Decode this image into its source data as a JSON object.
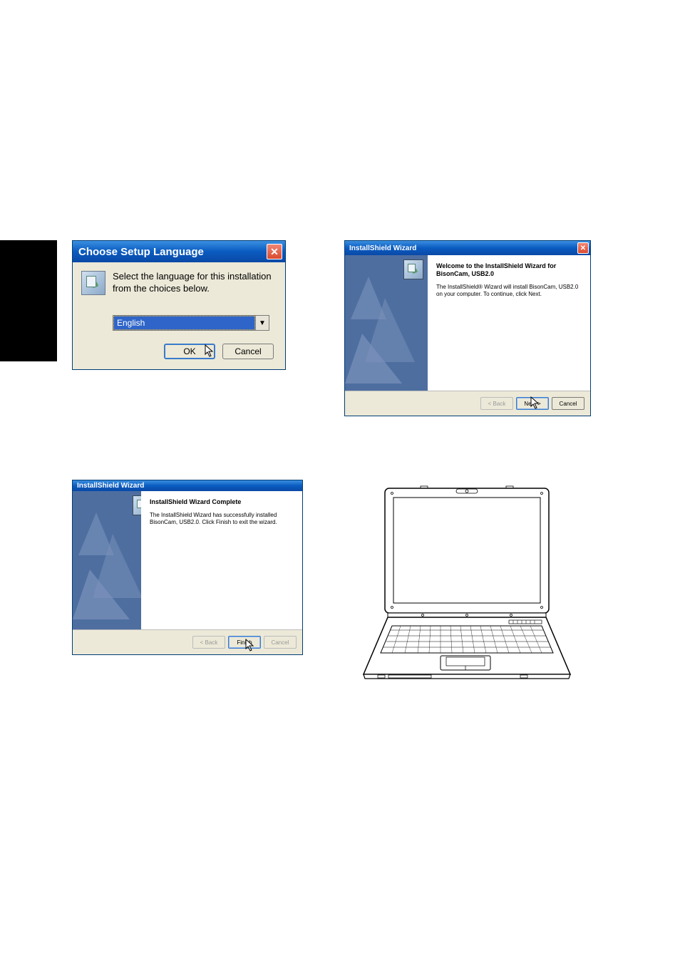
{
  "dialog1": {
    "title": "Choose Setup Language",
    "instruction": "Select the language for this installation from the choices below.",
    "selected_language": "English",
    "buttons": {
      "ok": "OK",
      "cancel": "Cancel"
    }
  },
  "dialog2": {
    "title": "InstallShield Wizard",
    "heading": "Welcome to the InstallShield Wizard for BisonCam, USB2.0",
    "body": "The InstallShield® Wizard will install BisonCam, USB2.0 on your computer.  To continue, click Next.",
    "buttons": {
      "back": "< Back",
      "next": "Next >",
      "cancel": "Cancel"
    }
  },
  "dialog3": {
    "title": "InstallShield Wizard",
    "heading": "InstallShield Wizard Complete",
    "body": "The InstallShield Wizard has successfully installed BisonCam, USB2.0.  Click Finish to exit the wizard.",
    "buttons": {
      "back": "< Back",
      "finish": "Finish",
      "cancel": "Cancel"
    }
  }
}
